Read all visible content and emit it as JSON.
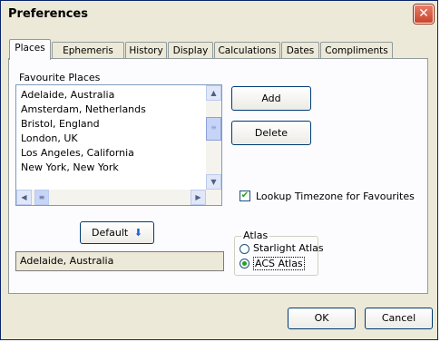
{
  "window": {
    "title": "Preferences",
    "close_glyph": "✕"
  },
  "tabs": [
    {
      "label": "Places",
      "active": true
    },
    {
      "label": "Ephemeris"
    },
    {
      "label": "History"
    },
    {
      "label": "Display"
    },
    {
      "label": "Calculations"
    },
    {
      "label": "Dates"
    },
    {
      "label": "Compliments"
    }
  ],
  "places": {
    "list_label": "Favourite Places",
    "items": [
      "Adelaide, Australia",
      "Amsterdam, Netherlands",
      "Bristol, England",
      "London, UK",
      "Los Angeles, California",
      "New York, New York"
    ],
    "add_label": "Add",
    "delete_label": "Delete",
    "default_label": "Default",
    "default_value": "Adelaide, Australia",
    "lookup_timezone_label": "Lookup Timezone for Favourites",
    "lookup_timezone_checked": true,
    "atlas": {
      "label": "Atlas",
      "options": [
        {
          "label": "Starlight Atlas",
          "selected": false
        },
        {
          "label": "ACS Atlas",
          "selected": true
        }
      ]
    }
  },
  "footer": {
    "ok_label": "OK",
    "cancel_label": "Cancel"
  },
  "icons": {
    "scroll_up": "▲",
    "scroll_down": "▼",
    "scroll_left": "◀",
    "scroll_right": "▶",
    "thumb_grip": "≡",
    "down_arrow": "⬇",
    "check": "✔"
  },
  "colors": {
    "accent_blue": "#2060e0",
    "close_red": "#c9452b",
    "check_green": "#21a121"
  }
}
